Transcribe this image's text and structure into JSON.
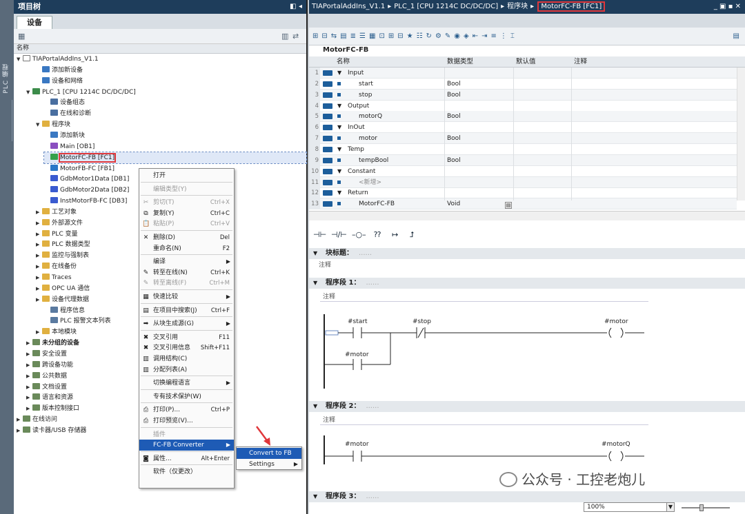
{
  "side_strip": {
    "label": "PLC 编程"
  },
  "left": {
    "title": "项目树",
    "title_controls": "◧ ◂",
    "tab": "设备",
    "col_header": "名称",
    "tree": [
      {
        "label": "TIAPortalAddIns_V1.1",
        "level": 0,
        "arrow": "▼",
        "icon": "doc",
        "color": "#ffffff"
      },
      {
        "label": "添加新设备",
        "level": 2,
        "arrow": "",
        "icon": "add",
        "color": "#3a78c2"
      },
      {
        "label": "设备和网络",
        "level": 2,
        "arrow": "",
        "icon": "net",
        "color": "#3a78c2"
      },
      {
        "label": "PLC_1 [CPU 1214C DC/DC/DC]",
        "level": 1,
        "arrow": "▼",
        "icon": "plc",
        "color": "#3c8c4a"
      },
      {
        "label": "设备组态",
        "level": 3,
        "arrow": "",
        "icon": "cfg",
        "color": "#4a6fa0"
      },
      {
        "label": "在线和诊断",
        "level": 3,
        "arrow": "",
        "icon": "diag",
        "color": "#4a6fa0"
      },
      {
        "label": "程序块",
        "level": 2,
        "arrow": "▼",
        "icon": "folder",
        "color": "#e0b040"
      },
      {
        "label": "添加新块",
        "level": 3,
        "arrow": "",
        "icon": "add",
        "color": "#3a78c2"
      },
      {
        "label": "Main [OB1]",
        "level": 3,
        "arrow": "",
        "icon": "ob",
        "color": "#8a4fc0"
      },
      {
        "label": "MotorFC-FB [FC1]",
        "level": 3,
        "arrow": "",
        "icon": "fc",
        "color": "#35a04a",
        "selected": true
      },
      {
        "label": "MotorFB-FC [FB1]",
        "level": 3,
        "arrow": "",
        "icon": "fb",
        "color": "#2a78c8"
      },
      {
        "label": "GdbMotor1Data [DB1]",
        "level": 3,
        "arrow": "",
        "icon": "db",
        "color": "#3a5bd0"
      },
      {
        "label": "GdbMotor2Data [DB2]",
        "level": 3,
        "arrow": "",
        "icon": "db",
        "color": "#3a5bd0"
      },
      {
        "label": "InstMotorFB-FC [DB3]",
        "level": 3,
        "arrow": "",
        "icon": "db",
        "color": "#3a5bd0"
      },
      {
        "label": "工艺对象",
        "level": 2,
        "arrow": "▶",
        "icon": "folder",
        "color": "#e0b040"
      },
      {
        "label": "外部源文件",
        "level": 2,
        "arrow": "▶",
        "icon": "folder",
        "color": "#e0b040"
      },
      {
        "label": "PLC 变量",
        "level": 2,
        "arrow": "▶",
        "icon": "folder",
        "color": "#e0b040"
      },
      {
        "label": "PLC 数据类型",
        "level": 2,
        "arrow": "▶",
        "icon": "folder",
        "color": "#e0b040"
      },
      {
        "label": "监控与强制表",
        "level": 2,
        "arrow": "▶",
        "icon": "folder",
        "color": "#e0b040"
      },
      {
        "label": "在线备份",
        "level": 2,
        "arrow": "▶",
        "icon": "folder",
        "color": "#e0b040"
      },
      {
        "label": "Traces",
        "level": 2,
        "arrow": "▶",
        "icon": "folder",
        "color": "#e0b040"
      },
      {
        "label": "OPC UA 通信",
        "level": 2,
        "arrow": "▶",
        "icon": "folder",
        "color": "#e0b040"
      },
      {
        "label": "设备代理数据",
        "level": 2,
        "arrow": "▶",
        "icon": "folder",
        "color": "#e0b040"
      },
      {
        "label": "程序信息",
        "level": 3,
        "arrow": "",
        "icon": "info",
        "color": "#5a7aa0"
      },
      {
        "label": "PLC 报警文本列表",
        "level": 3,
        "arrow": "",
        "icon": "info",
        "color": "#5a7aa0"
      },
      {
        "label": "本地模块",
        "level": 2,
        "arrow": "▶",
        "icon": "folder",
        "color": "#e0b040"
      },
      {
        "label": "未分组的设备",
        "level": 1,
        "arrow": "▶",
        "icon": "folder",
        "color": "#6a8a5a",
        "bold": true
      },
      {
        "label": "安全设置",
        "level": 1,
        "arrow": "▶",
        "icon": "folder",
        "color": "#6a8a5a"
      },
      {
        "label": "跨设备功能",
        "level": 1,
        "arrow": "▶",
        "icon": "folder",
        "color": "#6a8a5a"
      },
      {
        "label": "公共数据",
        "level": 1,
        "arrow": "▶",
        "icon": "folder",
        "color": "#6a8a5a"
      },
      {
        "label": "文档设置",
        "level": 1,
        "arrow": "▶",
        "icon": "folder",
        "color": "#6a8a5a"
      },
      {
        "label": "语言和资源",
        "level": 1,
        "arrow": "▶",
        "icon": "folder",
        "color": "#6a8a5a"
      },
      {
        "label": "版本控制接口",
        "level": 1,
        "arrow": "▶",
        "icon": "folder",
        "color": "#6a8a5a"
      },
      {
        "label": "在线访问",
        "level": 0,
        "arrow": "▶",
        "icon": "folder",
        "color": "#6a8a5a"
      },
      {
        "label": "读卡器/USB 存储器",
        "level": 0,
        "arrow": "▶",
        "icon": "folder",
        "color": "#6a8a5a"
      }
    ]
  },
  "context_menu": {
    "items": [
      {
        "label": "打开",
        "shortcut": "",
        "disabled": false,
        "sub": false,
        "icon": ""
      },
      {
        "sep": true
      },
      {
        "label": "编辑类型(Y)",
        "shortcut": "",
        "disabled": true,
        "sub": false,
        "icon": ""
      },
      {
        "sep": true
      },
      {
        "label": "剪切(T)",
        "shortcut": "Ctrl+X",
        "disabled": true,
        "sub": false,
        "icon": "✂"
      },
      {
        "label": "复制(Y)",
        "shortcut": "Ctrl+C",
        "disabled": false,
        "sub": false,
        "icon": "⧉"
      },
      {
        "label": "粘贴(P)",
        "shortcut": "Ctrl+V",
        "disabled": true,
        "sub": false,
        "icon": "📋"
      },
      {
        "sep": true
      },
      {
        "label": "删除(D)",
        "shortcut": "Del",
        "disabled": false,
        "sub": false,
        "icon": "✕"
      },
      {
        "label": "重命名(N)",
        "shortcut": "F2",
        "disabled": false,
        "sub": false,
        "icon": ""
      },
      {
        "sep": true
      },
      {
        "label": "编译",
        "shortcut": "",
        "disabled": false,
        "sub": true,
        "icon": ""
      },
      {
        "label": "转至在线(N)",
        "shortcut": "Ctrl+K",
        "disabled": false,
        "sub": false,
        "icon": "✎"
      },
      {
        "label": "转至离线(F)",
        "shortcut": "Ctrl+M",
        "disabled": true,
        "sub": false,
        "icon": "✎"
      },
      {
        "sep": true
      },
      {
        "label": "快速比较",
        "shortcut": "",
        "disabled": false,
        "sub": true,
        "icon": "▦"
      },
      {
        "sep": true
      },
      {
        "label": "在项目中搜索(J)",
        "shortcut": "Ctrl+F",
        "disabled": false,
        "sub": false,
        "icon": "▤"
      },
      {
        "sep": true
      },
      {
        "label": "从块生成源(G)",
        "shortcut": "",
        "disabled": false,
        "sub": true,
        "icon": "➡"
      },
      {
        "sep": true
      },
      {
        "label": "交叉引用",
        "shortcut": "F11",
        "disabled": false,
        "sub": false,
        "icon": "✖"
      },
      {
        "label": "交叉引用信息",
        "shortcut": "Shift+F11",
        "disabled": false,
        "sub": false,
        "icon": "✖"
      },
      {
        "label": "调用结构(C)",
        "shortcut": "",
        "disabled": false,
        "sub": false,
        "icon": "▥"
      },
      {
        "label": "分配列表(A)",
        "shortcut": "",
        "disabled": false,
        "sub": false,
        "icon": "▥"
      },
      {
        "sep": true
      },
      {
        "label": "切换编程语言",
        "shortcut": "",
        "disabled": false,
        "sub": true,
        "icon": ""
      },
      {
        "sep": true
      },
      {
        "label": "专有技术保护(W)",
        "shortcut": "",
        "disabled": false,
        "sub": false,
        "icon": ""
      },
      {
        "sep": true
      },
      {
        "label": "打印(P)...",
        "shortcut": "Ctrl+P",
        "disabled": false,
        "sub": false,
        "icon": "⎙"
      },
      {
        "label": "打印预览(V)...",
        "shortcut": "",
        "disabled": false,
        "sub": false,
        "icon": "⎙"
      },
      {
        "sep": true
      },
      {
        "label": "插件",
        "shortcut": "",
        "disabled": true,
        "sub": false,
        "icon": ""
      },
      {
        "label": "FC-FB Converter",
        "shortcut": "",
        "disabled": false,
        "sub": true,
        "icon": "",
        "highlight": true
      },
      {
        "sep": true
      },
      {
        "label": "属性...",
        "shortcut": "Alt+Enter",
        "disabled": false,
        "sub": false,
        "icon": "◙"
      },
      {
        "sep": true
      },
      {
        "label": "软件（仅更改）",
        "shortcut": "",
        "disabled": false,
        "sub": false,
        "icon": ""
      }
    ],
    "submenu": [
      {
        "label": "Convert to FB",
        "highlight": true
      },
      {
        "label": "Settings",
        "highlight": false,
        "sub": true
      }
    ]
  },
  "right": {
    "breadcrumbs": [
      "TIAPortalAddIns_V1.1",
      "PLC_1 [CPU 1214C DC/DC/DC]",
      "程序块"
    ],
    "current": "MotorFC-FB [FC1]",
    "window_controls": "_ ▣ ▪ ✕",
    "block_name": "MotorFC-FB",
    "columns": [
      "名称",
      "数据类型",
      "默认值",
      "注释"
    ],
    "rows": [
      {
        "n": "1",
        "name": "Input",
        "type": "",
        "section": true
      },
      {
        "n": "2",
        "name": "start",
        "type": "Bool",
        "section": false
      },
      {
        "n": "3",
        "name": "stop",
        "type": "Bool",
        "section": false
      },
      {
        "n": "4",
        "name": "Output",
        "type": "",
        "section": true
      },
      {
        "n": "5",
        "name": "motorQ",
        "type": "Bool",
        "section": false
      },
      {
        "n": "6",
        "name": "InOut",
        "type": "",
        "section": true
      },
      {
        "n": "7",
        "name": "motor",
        "type": "Bool",
        "section": false
      },
      {
        "n": "8",
        "name": "Temp",
        "type": "",
        "section": true
      },
      {
        "n": "9",
        "name": "tempBool",
        "type": "Bool",
        "section": false
      },
      {
        "n": "10",
        "name": "Constant",
        "type": "",
        "section": true
      },
      {
        "n": "11",
        "name": "<新增>",
        "type": "",
        "section": false,
        "placeholder": true
      },
      {
        "n": "12",
        "name": "Return",
        "type": "",
        "section": true
      },
      {
        "n": "13",
        "name": "MotorFC-FB",
        "type": "Void",
        "section": false
      }
    ],
    "ladder_tools": [
      "⊣⊢",
      "⊣/⊢",
      "–○–",
      "⁇",
      "↦",
      "⮥"
    ],
    "block_title_label": "块标题：",
    "block_comment": "注释",
    "segments": [
      {
        "title": "程序段 1：",
        "comment": "注释",
        "contacts": [
          "#start",
          "#stop",
          "#motor"
        ],
        "coil": "#motor"
      },
      {
        "title": "程序段 2：",
        "comment": "注释",
        "contacts": [
          "#motor"
        ],
        "coil": "#motorQ"
      },
      {
        "title": "程序段 3：",
        "comment": "",
        "contacts": [],
        "coil": ""
      }
    ],
    "zoom": "100%"
  },
  "watermark": "公众号 · 工控老炮儿"
}
